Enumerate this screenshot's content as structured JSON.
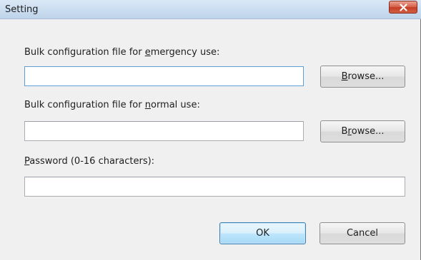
{
  "window": {
    "title": "Setting",
    "close_icon": "close-icon"
  },
  "emergency": {
    "label_pre": "Bulk configuration file for ",
    "label_key": "e",
    "label_post": "mergency use:",
    "value": "",
    "browse_key": "B",
    "browse_rest": "rowse..."
  },
  "normal": {
    "label_pre": "Bulk configuration file for ",
    "label_key": "n",
    "label_post": "ormal use:",
    "value": "",
    "browse_pre": "B",
    "browse_key": "r",
    "browse_post": "owse..."
  },
  "password": {
    "label_key": "P",
    "label_post": "assword (0-16 characters):",
    "value": ""
  },
  "buttons": {
    "ok": "OK",
    "cancel": "Cancel"
  },
  "colors": {
    "dialog_bg": "#f0f0f0",
    "close_button": "#c53d24",
    "default_button_border": "#3c7fb1"
  }
}
